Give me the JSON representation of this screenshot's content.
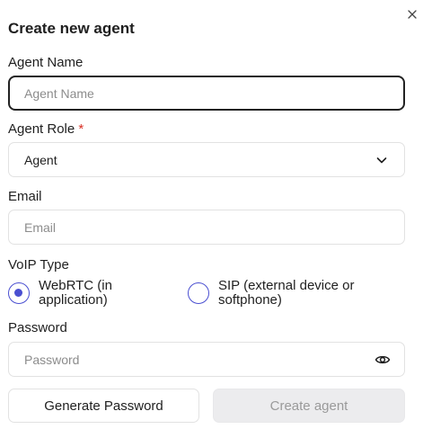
{
  "dialog": {
    "title": "Create new agent"
  },
  "agent_name": {
    "label": "Agent Name",
    "placeholder": "Agent Name",
    "value": ""
  },
  "agent_role": {
    "label": "Agent Role",
    "required_marker": "*",
    "selected": "Agent"
  },
  "email": {
    "label": "Email",
    "placeholder": "Email",
    "value": ""
  },
  "voip": {
    "label": "VoIP Type",
    "options": [
      {
        "line1": "WebRTC (in",
        "line2": "application)",
        "selected": true
      },
      {
        "line1": "SIP (external device or",
        "line2": "softphone)",
        "selected": false
      }
    ]
  },
  "password": {
    "label": "Password",
    "placeholder": "Password",
    "value": ""
  },
  "actions": {
    "generate_label": "Generate Password",
    "create_label": "Create agent"
  },
  "colors": {
    "accent": "#4a4fd1",
    "required": "#d93025",
    "disabled_bg": "#ececee",
    "disabled_text": "#9a9a9a"
  },
  "icons": {
    "close": "close-icon",
    "select": "chevron-down-icon",
    "password_toggle": "eye-icon"
  }
}
